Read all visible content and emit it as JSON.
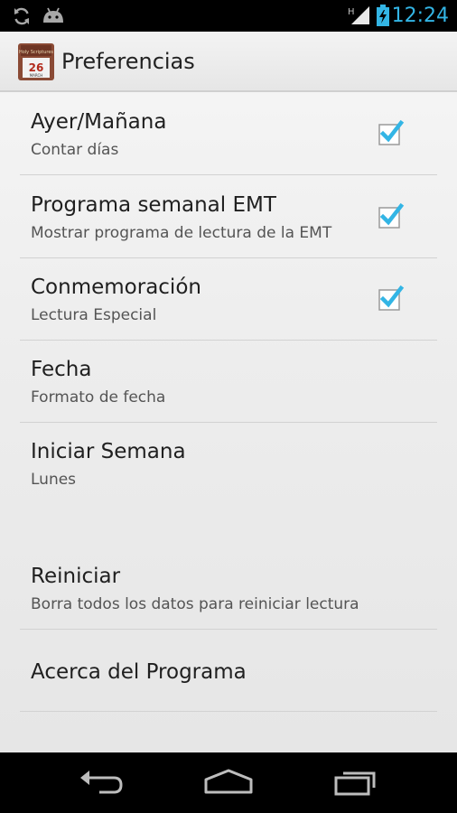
{
  "status_bar": {
    "icons": [
      "sync-icon",
      "android-debug-icon",
      "signal-h-icon",
      "battery-charging-icon"
    ],
    "signal_label": "H",
    "time": "12:24",
    "accent_color": "#33b5e5"
  },
  "action_bar": {
    "title": "Preferencias",
    "app_icon": {
      "banner_text": "Holy Scriptures",
      "day": "26",
      "month": "MARCH"
    }
  },
  "preferences": [
    {
      "title": "Ayer/Mañana",
      "summary": "Contar días",
      "checked": true
    },
    {
      "title": "Programa semanal EMT",
      "summary": "Mostrar programa de lectura de la EMT",
      "checked": true
    },
    {
      "title": "Conmemoración",
      "summary": "Lectura Especial",
      "checked": true
    },
    {
      "title": "Fecha",
      "summary": "Formato de fecha"
    },
    {
      "title": "Iniciar Semana",
      "summary": "Lunes"
    },
    {
      "title": "Reiniciar",
      "summary": "Borra todos los datos para reiniciar lectura"
    },
    {
      "title": "Acerca del Programa"
    }
  ],
  "navigation_bar": {
    "buttons": [
      "back-icon",
      "home-icon",
      "recent-apps-icon"
    ]
  },
  "colors": {
    "checkmark": "#33b5e5",
    "divider": "#d2d2d2"
  }
}
